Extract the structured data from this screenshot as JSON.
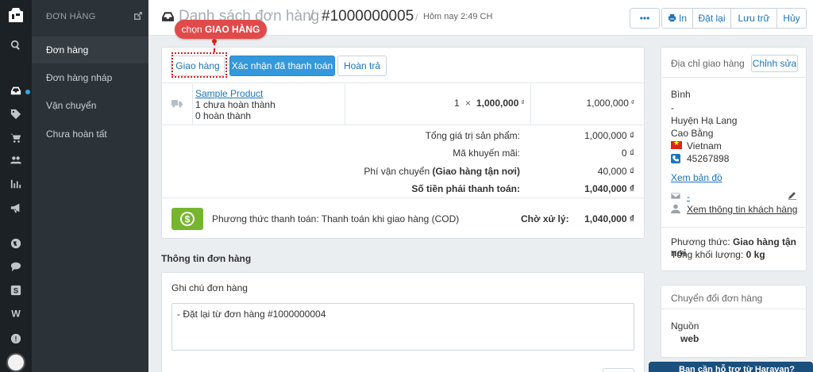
{
  "colors": {
    "accent": "#1b75bb",
    "primary_button": "#3398dc",
    "callout": "#e04a4a",
    "payment_icon_bg": "#76b52e"
  },
  "sidebar": {
    "section_title": "ĐƠN HÀNG",
    "items": [
      {
        "label": "Đơn hàng",
        "active": true
      },
      {
        "label": "Đơn hàng nháp"
      },
      {
        "label": "Vận chuyển"
      },
      {
        "label": "Chưa hoàn tất"
      }
    ],
    "rail_icons": [
      "logo-icon",
      "search-icon",
      "inbox-icon",
      "tag-icon",
      "cart-icon",
      "users-icon",
      "bar-chart-icon",
      "megaphone-icon",
      "globe-icon",
      "chat-icon",
      "s-icon",
      "w-icon",
      "avatar"
    ]
  },
  "header": {
    "list_title": "Danh sách đơn hàng",
    "separator": "/",
    "order_number": "#1000000005",
    "timestamp": "Hôm nay 2:49 CH",
    "buttons": {
      "more": "•••",
      "print": "In",
      "reset": "Đặt lại",
      "archive": "Lưu trữ",
      "cancel": "Hủy"
    }
  },
  "callout": {
    "prefix": "chọn",
    "emphasis": "GIAO HÀNG"
  },
  "order_panel": {
    "tabs": [
      "Giao hàng",
      "Xác nhận đã thanh toán",
      "Hoàn trả"
    ],
    "item": {
      "name": "Sample Product",
      "unfulfilled": "1 chưa hoàn thành",
      "fulfilled": "0 hoàn thành",
      "qty": "1",
      "times": "×",
      "price": "1,000,000",
      "currency": "₫",
      "total": "1,000,000"
    },
    "summary": [
      {
        "label": "Tổng giá trị sản phẩm:",
        "value": "1,000,000 ₫"
      },
      {
        "label": "Mã khuyến mãi:",
        "value": "0 ₫"
      },
      {
        "label_prefix": "Phí vận chuyển ",
        "label_bold": "(Giao hàng tận nơi)",
        "value": "40,000 ₫"
      },
      {
        "label": "Số tiền phải thanh toán:",
        "value": "1,040,000 ₫"
      }
    ],
    "payment": {
      "method": "Phương thức thanh toán: Thanh toán khi giao hàng (COD)",
      "status": "Chờ xử lý:",
      "amount": "1,040,000 ₫"
    }
  },
  "order_info": {
    "title": "Thông tin đơn hàng",
    "notes_label": "Ghi chú đơn hàng",
    "notes_value": "- Đặt lại từ đơn hàng #1000000004"
  },
  "shipping_address": {
    "title": "Địa chỉ giao hàng",
    "edit": "Chỉnh sửa",
    "name": "Bình",
    "line2": "-",
    "district": "Huyện Hạ Lang",
    "province": "Cao Bằng",
    "country": "Vietnam",
    "phone": "45267898",
    "map_link": "Xem bản đồ",
    "email": "-",
    "customer_link": "Xem thông tin khách hàng",
    "shipping_method_label": "Phương thức:",
    "shipping_method": "Giao hàng tận nơi",
    "weight_label": "Tổng khối lượng:",
    "weight": "0 kg"
  },
  "conversion": {
    "title": "Chuyển đổi đơn hàng",
    "source_label": "Nguồn",
    "source": "web"
  },
  "chat_bar": {
    "label": "Bạn cần hỗ trợ từ Haravan?"
  }
}
